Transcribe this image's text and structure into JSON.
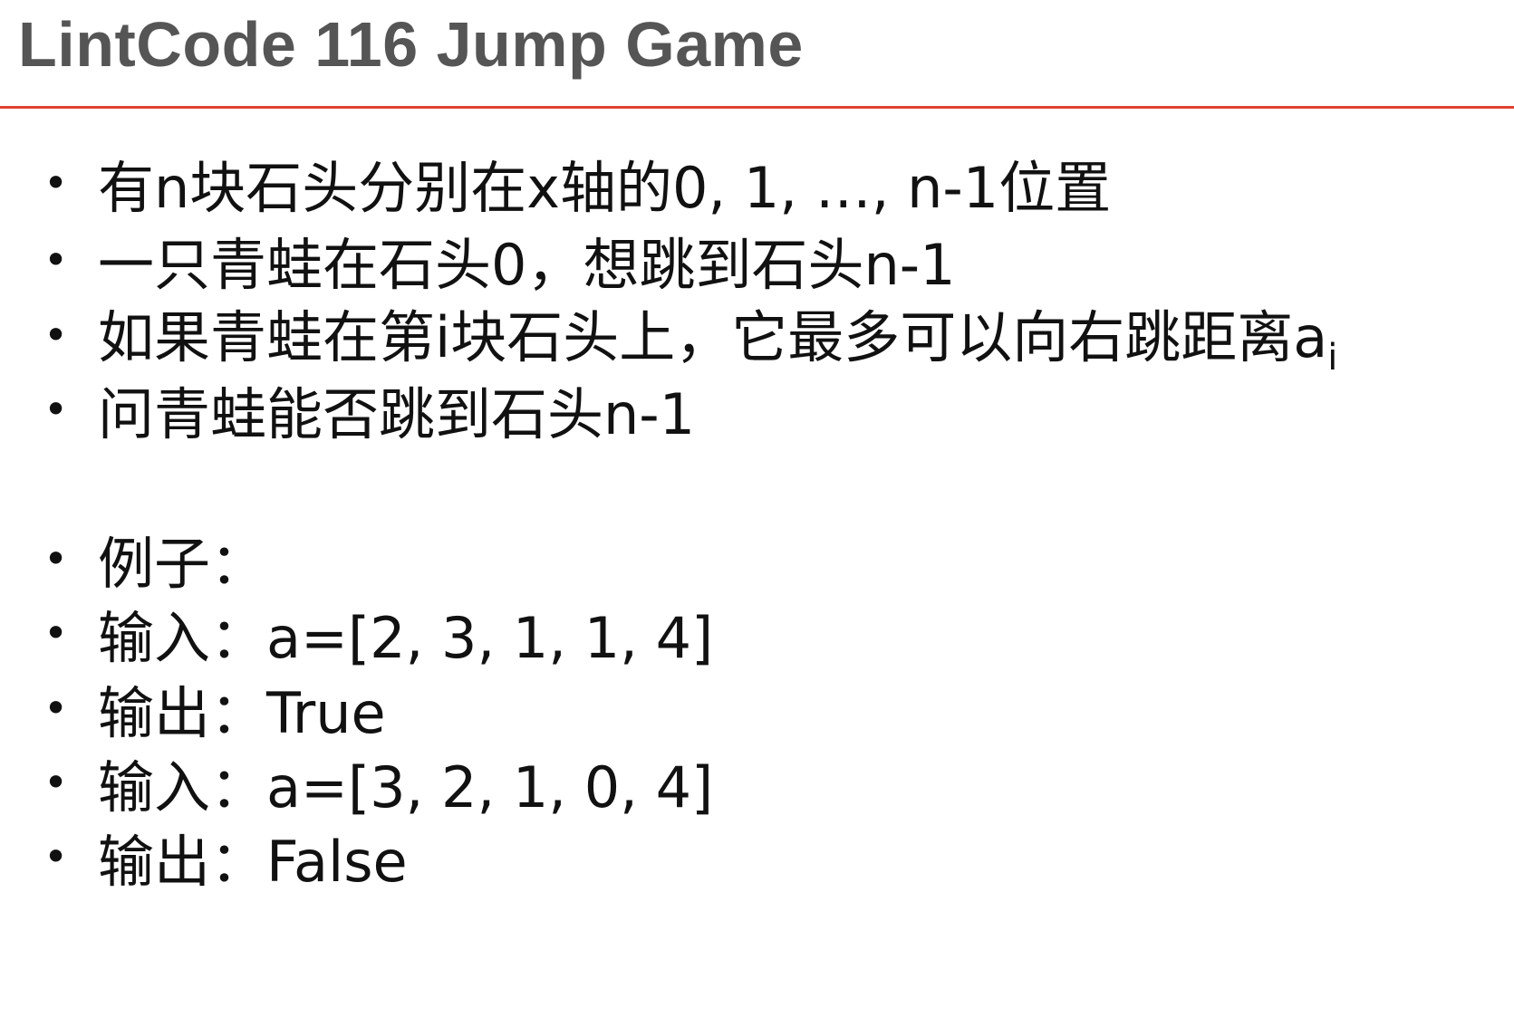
{
  "slide": {
    "title": "LintCode 116 Jump Game",
    "accent_color": "#e0412f",
    "bullet_symbol": "•",
    "problem_bullets": [
      "有n块石头分别在x轴的0, 1, …, n-1位置",
      "一只青蛙在石头0，想跳到石头n-1",
      "如果青蛙在第i块石头上，它最多可以向右跳距离a",
      "问青蛙能否跳到石头n-1"
    ],
    "distance_subscript": "i",
    "example_bullets": [
      "例子：",
      "输入：a=[2, 3, 1, 1, 4]",
      "输出：True",
      "输入：a=[3, 2, 1, 0, 4]",
      "输出：False"
    ]
  }
}
